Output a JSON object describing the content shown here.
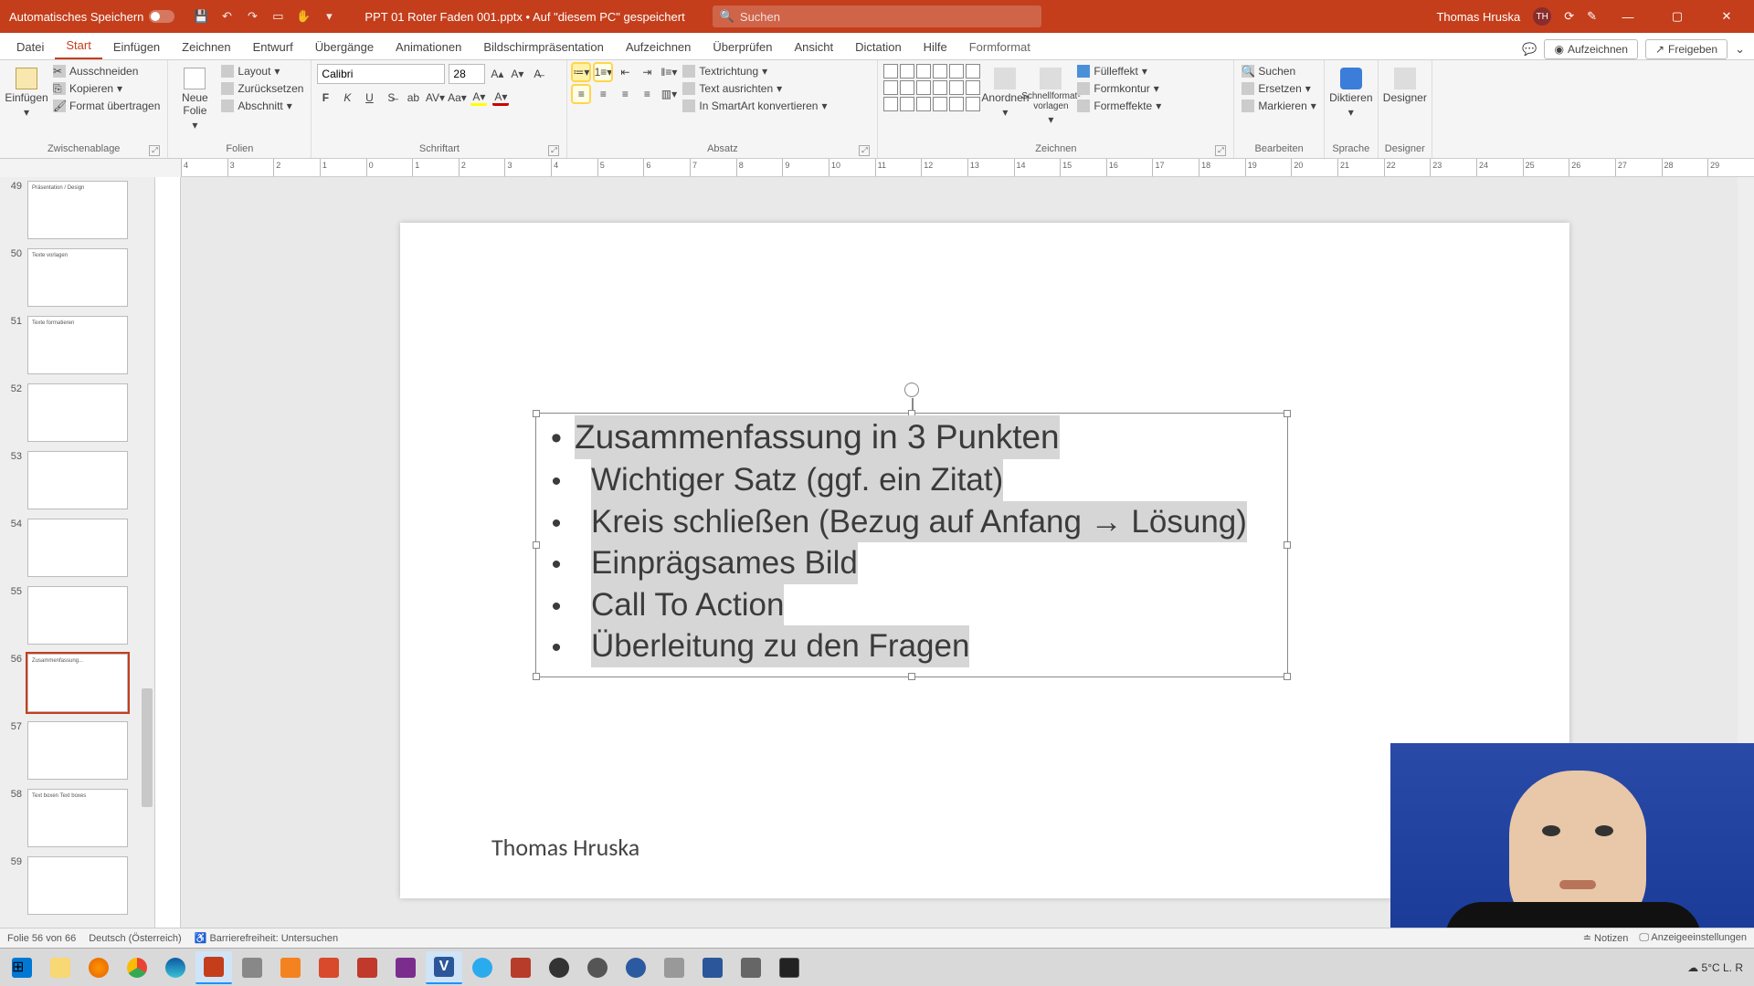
{
  "titlebar": {
    "autosave_label": "Automatisches Speichern",
    "filename": "PPT 01 Roter Faden 001.pptx • Auf \"diesem PC\" gespeichert",
    "search_placeholder": "Suchen",
    "user_name": "Thomas Hruska",
    "user_initials": "TH"
  },
  "tabs": {
    "datei": "Datei",
    "start": "Start",
    "einfuegen": "Einfügen",
    "zeichnen": "Zeichnen",
    "entwurf": "Entwurf",
    "uebergaenge": "Übergänge",
    "animationen": "Animationen",
    "bildschirm": "Bildschirmpräsentation",
    "aufzeichnen": "Aufzeichnen",
    "ueberpruefen": "Überprüfen",
    "ansicht": "Ansicht",
    "dictation": "Dictation",
    "hilfe": "Hilfe",
    "formformat": "Formformat",
    "aufzeichnen_btn": "Aufzeichnen",
    "freigeben": "Freigeben"
  },
  "ribbon": {
    "clipboard": {
      "einfuegen": "Einfügen",
      "ausschneiden": "Ausschneiden",
      "kopieren": "Kopieren",
      "format_uebertragen": "Format übertragen",
      "label": "Zwischenablage"
    },
    "folien": {
      "neue_folie": "Neue\nFolie",
      "layout": "Layout",
      "zuruecksetzen": "Zurücksetzen",
      "abschnitt": "Abschnitt",
      "label": "Folien"
    },
    "schriftart": {
      "font_name": "Calibri",
      "font_size": "28",
      "label": "Schriftart"
    },
    "absatz": {
      "textrichtung": "Textrichtung",
      "text_ausrichten": "Text ausrichten",
      "smartart": "In SmartArt konvertieren",
      "label": "Absatz"
    },
    "zeichnen": {
      "anordnen": "Anordnen",
      "schnellformat": "Schnellformat-\nvorlagen",
      "fuelleffekt": "Fülleffekt",
      "formkontur": "Formkontur",
      "formeffekte": "Formeffekte",
      "label": "Zeichnen"
    },
    "bearbeiten": {
      "suchen": "Suchen",
      "ersetzen": "Ersetzen",
      "markieren": "Markieren",
      "label": "Bearbeiten"
    },
    "sprache": {
      "diktieren": "Diktieren",
      "label": "Sprache"
    },
    "designer": {
      "designer": "Designer",
      "label": "Designer"
    }
  },
  "ruler_h": [
    "4",
    "3",
    "2",
    "1",
    "0",
    "1",
    "2",
    "3",
    "4",
    "5",
    "6",
    "7",
    "8",
    "9",
    "10",
    "11",
    "12",
    "13",
    "14",
    "15",
    "16",
    "17",
    "18",
    "19",
    "20",
    "21",
    "22",
    "23",
    "24",
    "25",
    "26",
    "27",
    "28",
    "29"
  ],
  "thumbnails": [
    {
      "num": "49",
      "caption": "Präsentation / Design"
    },
    {
      "num": "50",
      "caption": "Texte vorlagen"
    },
    {
      "num": "51",
      "caption": "Texte formatieren"
    },
    {
      "num": "52",
      "caption": ""
    },
    {
      "num": "53",
      "caption": ""
    },
    {
      "num": "54",
      "caption": ""
    },
    {
      "num": "55",
      "caption": ""
    },
    {
      "num": "56",
      "caption": "Zusammenfassung..."
    },
    {
      "num": "57",
      "caption": ""
    },
    {
      "num": "58",
      "caption": "Text boxen\nText boxes"
    },
    {
      "num": "59",
      "caption": ""
    }
  ],
  "slide": {
    "bullets": [
      "Zusammenfassung in 3 Punkten",
      "Wichtiger Satz (ggf. ein Zitat)",
      "Kreis schließen (Bezug auf Anfang → Lösung)",
      "Einprägsames Bild",
      "Call To Action",
      "Überleitung zu den Fragen"
    ],
    "author": "Thomas Hruska"
  },
  "statusbar": {
    "slide_info": "Folie 56 von 66",
    "language": "Deutsch (Österreich)",
    "accessibility": "Barrierefreiheit: Untersuchen",
    "notizen": "Notizen",
    "anzeige": "Anzeigeeinstellungen"
  },
  "tray": {
    "weather": "5°C  L. R"
  }
}
